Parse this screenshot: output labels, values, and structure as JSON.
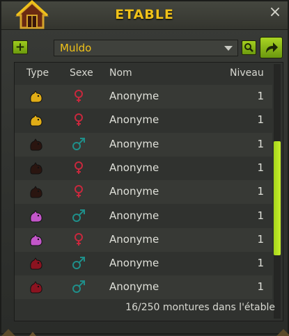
{
  "window": {
    "title": "ETABLE"
  },
  "toolbar": {
    "filter_selected": "Muldo",
    "add_label": "+"
  },
  "table": {
    "headers": {
      "type": "Type",
      "sex": "Sexe",
      "name": "Nom",
      "level": "Niveau"
    },
    "rows": [
      {
        "type_color": "#e1ad16",
        "sex": "female",
        "name": "Anonyme",
        "level": "1"
      },
      {
        "type_color": "#e1ad16",
        "sex": "female",
        "name": "Anonyme",
        "level": "1"
      },
      {
        "type_color": "#2a1510",
        "sex": "male",
        "name": "Anonyme",
        "level": "1"
      },
      {
        "type_color": "#2a1510",
        "sex": "female",
        "name": "Anonyme",
        "level": "1"
      },
      {
        "type_color": "#2a1510",
        "sex": "female",
        "name": "Anonyme",
        "level": "1"
      },
      {
        "type_color": "#c356c9",
        "sex": "male",
        "name": "Anonyme",
        "level": "1"
      },
      {
        "type_color": "#c356c9",
        "sex": "female",
        "name": "Anonyme",
        "level": "1"
      },
      {
        "type_color": "#8b1320",
        "sex": "male",
        "name": "Anonyme",
        "level": "1"
      },
      {
        "type_color": "#8b1320",
        "sex": "male",
        "name": "Anonyme",
        "level": "1"
      }
    ],
    "scroll_position": 0.55,
    "scroll_visible_fraction": 0.45
  },
  "footer": {
    "count_text": "16/250 montures dans l'étable"
  },
  "colors": {
    "accent": "#f0c219",
    "female": "#c8283d",
    "male": "#1f8f8a",
    "button_green": "#8ebe18"
  },
  "icons": [
    "home-icon",
    "close-icon",
    "add-icon",
    "chevron-down-icon",
    "search-icon",
    "share-arrow-icon",
    "female-icon",
    "male-icon",
    "muldo-icon"
  ]
}
